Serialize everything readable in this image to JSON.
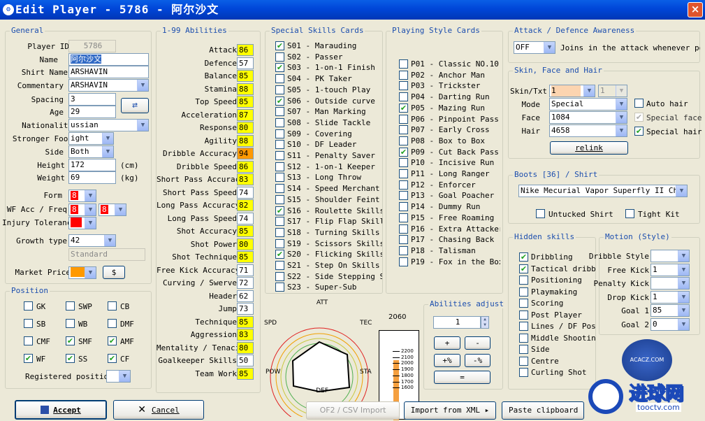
{
  "window": {
    "title": "Edit Player - 5786 - 阿尔沙文",
    "close": "×",
    "icon": "⚙"
  },
  "general": {
    "legend": "General",
    "player_id_label": "Player ID",
    "player_id": "5786",
    "name_label": "Name",
    "name": "阿尔沙文",
    "shirt_name_label": "Shirt Name",
    "shirt_name": "ARSHAVIN",
    "commentary_label": "Commentary",
    "commentary": "ARSHAVIN",
    "spacing_label": "Spacing",
    "spacing": "3",
    "age_label": "Age",
    "age": "29",
    "nationality_label": "Nationality",
    "nationality": "ussian",
    "stronger_foot_label": "Stronger Foot",
    "stronger_foot": "ight",
    "side_label": "Side",
    "side": "Both",
    "height_label": "Height",
    "height": "172",
    "height_unit": "(cm)",
    "weight_label": "Weight",
    "weight": "69",
    "weight_unit": "(kg)",
    "form_label": "Form",
    "form": "8",
    "wf_label": "WF Acc / Freq",
    "wf_acc": "8",
    "wf_freq": "8",
    "injury_label": "Injury Tolerance",
    "injury": "",
    "growth_label": "Growth type",
    "growth": "42",
    "growth_name": "Standard",
    "market_label": "Market Price",
    "market_btn": "$",
    "swap_icon": "⇄",
    "colors": {
      "red": "#FF0000",
      "orange": "#FF9900"
    }
  },
  "position": {
    "legend": "Position",
    "items": [
      {
        "label": "GK",
        "checked": false
      },
      {
        "label": "SWP",
        "checked": false
      },
      {
        "label": "CB",
        "checked": false
      },
      {
        "label": "SB",
        "checked": false
      },
      {
        "label": "WB",
        "checked": false
      },
      {
        "label": "DMF",
        "checked": false
      },
      {
        "label": "CMF",
        "checked": false
      },
      {
        "label": "SMF",
        "checked": true
      },
      {
        "label": "AMF",
        "checked": true
      },
      {
        "label": "WF",
        "checked": true
      },
      {
        "label": "SS",
        "checked": true
      },
      {
        "label": "CF",
        "checked": true
      }
    ],
    "registered_label": "Registered position",
    "registered": ""
  },
  "abilities": {
    "legend": "1-99 Abilities",
    "items": [
      {
        "name": "Attack",
        "value": "86",
        "color": "#FFFF00"
      },
      {
        "name": "Defence",
        "value": "57",
        "color": "#FFFFFF"
      },
      {
        "name": "Balance",
        "value": "85",
        "color": "#FFFF00"
      },
      {
        "name": "Stamina",
        "value": "88",
        "color": "#FFFF00"
      },
      {
        "name": "Top Speed",
        "value": "85",
        "color": "#FFFF00"
      },
      {
        "name": "Acceleration",
        "value": "87",
        "color": "#FFFF00"
      },
      {
        "name": "Response",
        "value": "80",
        "color": "#FFFF00"
      },
      {
        "name": "Agility",
        "value": "88",
        "color": "#FFFF00"
      },
      {
        "name": "Dribble Accuracy",
        "value": "94",
        "color": "#FF9900"
      },
      {
        "name": "Dribble Speed",
        "value": "86",
        "color": "#FFFF00"
      },
      {
        "name": "Short Pass Accuracy",
        "value": "83",
        "color": "#FFFF00"
      },
      {
        "name": "Short Pass Speed",
        "value": "74",
        "color": "#FFFFFF"
      },
      {
        "name": "Long Pass Accuracy",
        "value": "82",
        "color": "#FFFF00"
      },
      {
        "name": "Long Pass Speed",
        "value": "74",
        "color": "#FFFFFF"
      },
      {
        "name": "Shot Accuracy",
        "value": "85",
        "color": "#FFFF00"
      },
      {
        "name": "Shot Power",
        "value": "80",
        "color": "#FFFF00"
      },
      {
        "name": "Shot Technique",
        "value": "85",
        "color": "#FFFF00"
      },
      {
        "name": "Free Kick Accuracy",
        "value": "71",
        "color": "#FFFFFF"
      },
      {
        "name": "Curving / Swerve",
        "value": "72",
        "color": "#FFFFFF"
      },
      {
        "name": "Header",
        "value": "62",
        "color": "#FFFFFF"
      },
      {
        "name": "Jump",
        "value": "73",
        "color": "#FFFFFF"
      },
      {
        "name": "Technique",
        "value": "85",
        "color": "#FFFF00"
      },
      {
        "name": "Aggression",
        "value": "83",
        "color": "#FFFF00"
      },
      {
        "name": "Mentality / Tenacity",
        "value": "80",
        "color": "#FFFF00"
      },
      {
        "name": "Goalkeeper Skills",
        "value": "50",
        "color": "#FFFFFF"
      },
      {
        "name": "Team Work",
        "value": "85",
        "color": "#FFFF00"
      }
    ]
  },
  "special_skills": {
    "legend": "Special Skills Cards",
    "items": [
      {
        "label": "S01 - Marauding",
        "checked": true
      },
      {
        "label": "S02 - Passer",
        "checked": false
      },
      {
        "label": "S03 - 1-on-1 Finish",
        "checked": true
      },
      {
        "label": "S04 - PK Taker",
        "checked": false
      },
      {
        "label": "S05 - 1-touch Play",
        "checked": false
      },
      {
        "label": "S06 - Outside curve",
        "checked": true
      },
      {
        "label": "S07 - Man Marking",
        "checked": false
      },
      {
        "label": "S08 - Slide Tackle",
        "checked": false
      },
      {
        "label": "S09 - Covering",
        "checked": false
      },
      {
        "label": "S10 - DF Leader",
        "checked": false
      },
      {
        "label": "S11 - Penalty Saver",
        "checked": false
      },
      {
        "label": "S12 - 1-on-1 Keeper",
        "checked": false
      },
      {
        "label": "S13 - Long Throw",
        "checked": false
      },
      {
        "label": "S14 - Speed Merchant",
        "checked": false
      },
      {
        "label": "S15 - Shoulder Feint Sk",
        "checked": false
      },
      {
        "label": "S16 - Roulette Skills",
        "checked": true
      },
      {
        "label": "S17 - Flip Flap Skills",
        "checked": false
      },
      {
        "label": "S18 - Turning Skills",
        "checked": false
      },
      {
        "label": "S19 - Scissors Skills",
        "checked": false
      },
      {
        "label": "S20 - Flicking Skills",
        "checked": true
      },
      {
        "label": "S21 - Step On Skills",
        "checked": false
      },
      {
        "label": "S22 - Side Stepping Ski",
        "checked": false
      },
      {
        "label": "S23 - Super-Sub",
        "checked": false
      }
    ]
  },
  "playing_style": {
    "legend": "Playing Style Cards",
    "items": [
      {
        "label": "P01 - Classic NO.10",
        "checked": false
      },
      {
        "label": "P02 - Anchor Man",
        "checked": false
      },
      {
        "label": "P03 - Trickster",
        "checked": false
      },
      {
        "label": "P04 - Darting Run",
        "checked": false
      },
      {
        "label": "P05 - Mazing Run",
        "checked": true
      },
      {
        "label": "P06 - Pinpoint Pass",
        "checked": false
      },
      {
        "label": "P07 - Early Cross",
        "checked": false
      },
      {
        "label": "P08 - Box to Box",
        "checked": false
      },
      {
        "label": "P09 - Cut Back Pass",
        "checked": true
      },
      {
        "label": "P10 - Incisive Run",
        "checked": false
      },
      {
        "label": "P11 - Long Ranger",
        "checked": false
      },
      {
        "label": "P12 - Enforcer",
        "checked": false
      },
      {
        "label": "P13 - Goal Poacher",
        "checked": false
      },
      {
        "label": "P14 - Dummy Run",
        "checked": false
      },
      {
        "label": "P15 - Free Roaming",
        "checked": false
      },
      {
        "label": "P16 - Extra Attacker",
        "checked": false
      },
      {
        "label": "P17 - Chasing Back",
        "checked": false
      },
      {
        "label": "P18 - Talisman",
        "checked": false
      },
      {
        "label": "P19 - Fox in the Box",
        "checked": false
      }
    ]
  },
  "radar": {
    "att": "ATT",
    "spd": "SPD",
    "tec": "TEC",
    "pow": "POW",
    "sta": "STA",
    "def": "DEF",
    "total": "2060",
    "scale": [
      "2200",
      "2100",
      "2000",
      "1900",
      "1800",
      "1700",
      "1600"
    ]
  },
  "abilities_adjust": {
    "legend": "Abilities adjust",
    "value": "1",
    "plus": "+",
    "minus": "-",
    "plus_pct": "+%",
    "minus_pct": "-%",
    "equal": "="
  },
  "awareness": {
    "legend": "Attack / Defence Awareness",
    "value": "OFF",
    "text": "Joins in the attack whenever poss"
  },
  "skin": {
    "legend": "Skin, Face and Hair",
    "skin_label": "Skin/Txt",
    "skin": "1",
    "txt": "1",
    "mode_label": "Mode",
    "mode": "Special",
    "face_label": "Face",
    "face": "1084",
    "hair_label": "Hair",
    "hair": "4658",
    "auto_hair": "Auto hair",
    "special_face": "Special face",
    "special_hair": "Special hair",
    "relink": "relink"
  },
  "boots": {
    "legend": "Boots [36] / Shirt",
    "value": "Nike Mecurial Vapor Superfly II Cherr",
    "untucked": "Untucked Shirt",
    "tight": "Tight Kit"
  },
  "hidden": {
    "legend": "Hidden skills",
    "items": [
      {
        "label": "Dribbling",
        "checked": true
      },
      {
        "label": "Tactical dribbl",
        "checked": true
      },
      {
        "label": "Positioning",
        "checked": false
      },
      {
        "label": "Playmaking",
        "checked": false
      },
      {
        "label": "Scoring",
        "checked": false
      },
      {
        "label": "Post Player",
        "checked": false
      },
      {
        "label": "Lines / DF Pos.",
        "checked": false
      },
      {
        "label": "Middle Shooting",
        "checked": false
      },
      {
        "label": "Side",
        "checked": false
      },
      {
        "label": "Centre",
        "checked": false
      },
      {
        "label": "Curling Shot",
        "checked": false
      }
    ]
  },
  "motion": {
    "legend": "Motion (Style)",
    "items": [
      {
        "label": "Dribble Style",
        "value": ""
      },
      {
        "label": "Free Kick",
        "value": "1"
      },
      {
        "label": "Penalty Kick",
        "value": ""
      },
      {
        "label": "Drop Kick",
        "value": "1"
      },
      {
        "label": "Goal 1",
        "value": "85"
      },
      {
        "label": "Goal 2",
        "value": "0"
      }
    ]
  },
  "buttons": {
    "accept": "Accept",
    "cancel": "Cancel",
    "of2": "OF2 / CSV Import",
    "import_xml": "Import from XML",
    "paste": "Paste clipboard"
  },
  "watermark": {
    "site": "进球网",
    "url": "tooctv.com",
    "logo": "ACACZ.COM"
  }
}
